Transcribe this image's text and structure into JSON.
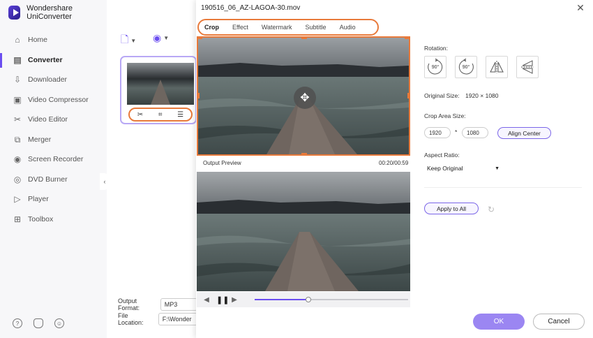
{
  "app": {
    "title": "Wondershare UniConverter",
    "nav": [
      {
        "label": "Home",
        "icon": "home-icon"
      },
      {
        "label": "Converter",
        "icon": "converter-icon",
        "active": true
      },
      {
        "label": "Downloader",
        "icon": "downloader-icon"
      },
      {
        "label": "Video Compressor",
        "icon": "compress-icon"
      },
      {
        "label": "Video Editor",
        "icon": "scissors-icon"
      },
      {
        "label": "Merger",
        "icon": "merge-icon"
      },
      {
        "label": "Screen Recorder",
        "icon": "record-icon"
      },
      {
        "label": "DVD Burner",
        "icon": "disc-icon"
      },
      {
        "label": "Player",
        "icon": "play-icon"
      },
      {
        "label": "Toolbox",
        "icon": "grid-icon"
      }
    ],
    "output_format_label": "Output Format:",
    "output_format_value": "MP3",
    "file_location_label": "File Location:",
    "file_location_value": "F:\\Wonder",
    "accent_color": "#6b4ef0",
    "highlight_color": "#e87a3b"
  },
  "dialog": {
    "title": "190516_06_AZ-LAGOA-30.mov",
    "tabs": [
      "Crop",
      "Effect",
      "Watermark",
      "Subtitle",
      "Audio"
    ],
    "active_tab": "Crop",
    "output_preview_label": "Output Preview",
    "time": "00:20/00:59",
    "playback_progress": 0.35,
    "rotation_label": "Rotation:",
    "rotate_cw_text": "90°",
    "rotate_ccw_text": "90°",
    "original_size_label": "Original Size:",
    "original_size_value": "1920 × 1080",
    "crop_area_label": "Crop Area Size:",
    "crop_width": "1920",
    "crop_height": "1080",
    "times_symbol": "*",
    "align_center": "Align Center",
    "aspect_ratio_label": "Aspect Ratio:",
    "aspect_ratio_value": "Keep Original",
    "apply_to_all": "Apply to All",
    "ok": "OK",
    "cancel": "Cancel"
  }
}
